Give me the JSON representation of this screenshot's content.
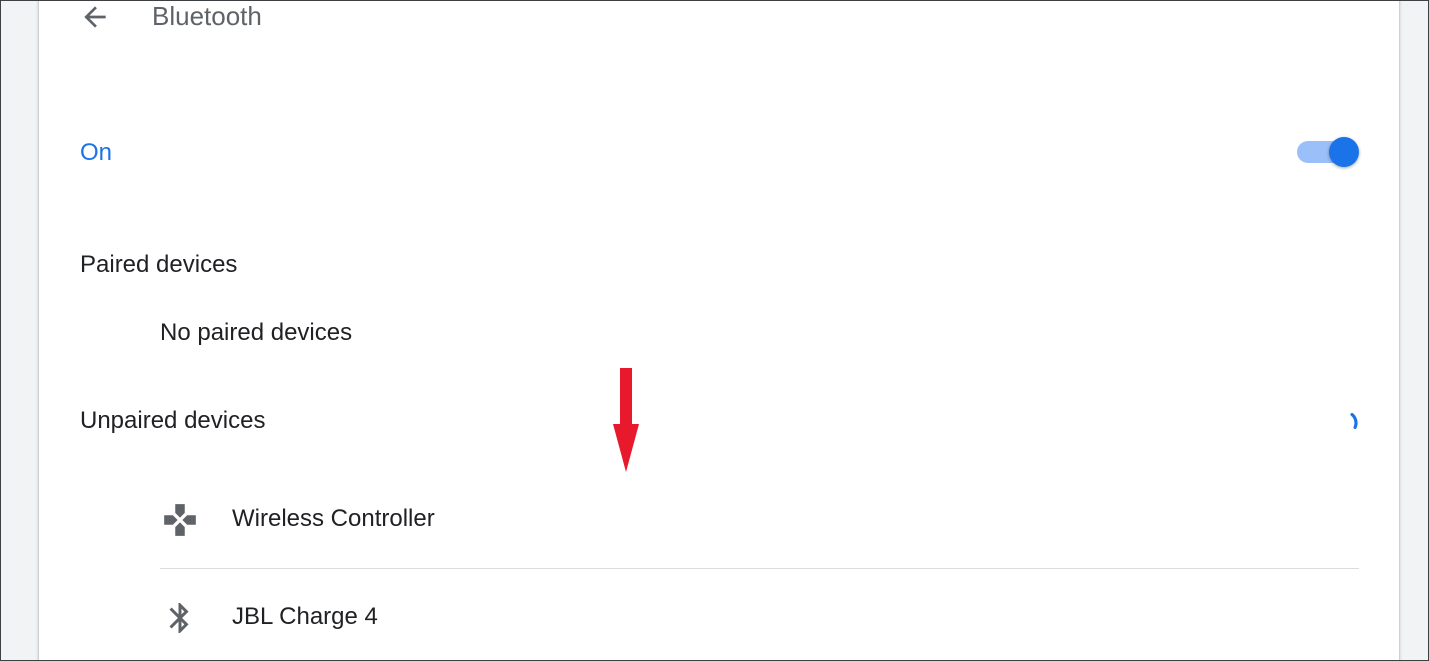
{
  "header": {
    "title": "Bluetooth",
    "back_icon": "arrow-back-icon"
  },
  "bluetooth_toggle": {
    "label": "On",
    "state": "on",
    "accent_color": "#1a73e8"
  },
  "paired": {
    "heading": "Paired devices",
    "empty_text": "No paired devices"
  },
  "unpaired": {
    "heading": "Unpaired devices",
    "scanning_icon": "loading-spinner-icon",
    "devices": [
      {
        "name": "Wireless Controller",
        "icon": "gamepad-icon"
      },
      {
        "name": "JBL Charge 4",
        "icon": "bluetooth-icon"
      }
    ]
  },
  "annotation": {
    "icon": "red-arrow-down-icon",
    "color": "#e8192c"
  }
}
